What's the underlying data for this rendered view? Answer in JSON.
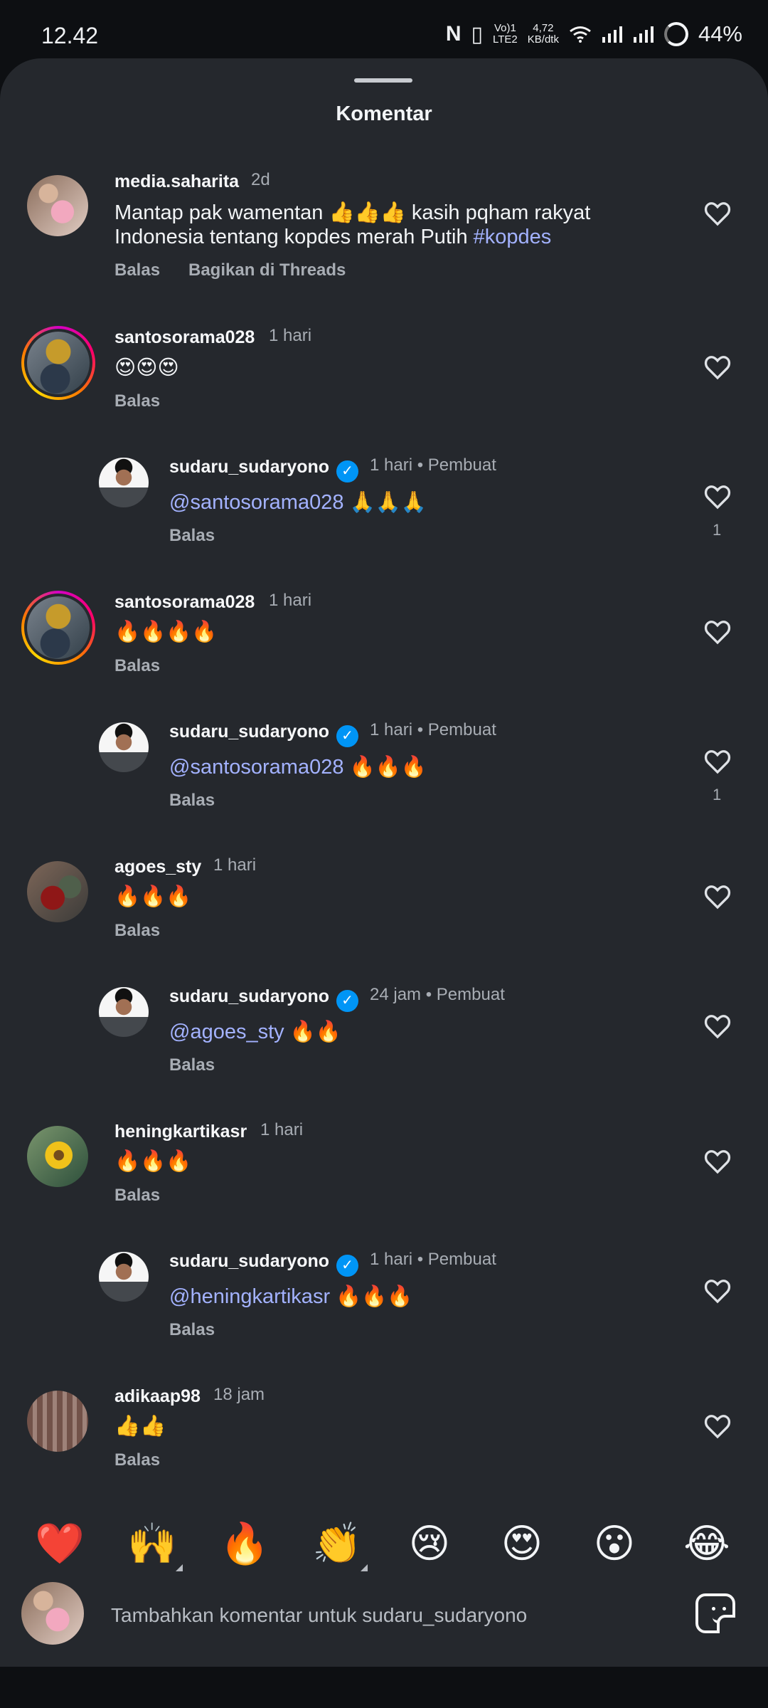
{
  "status": {
    "time": "12.42",
    "nfc": "N",
    "volte_top": "Vo)1",
    "volte_bottom": "LTE2",
    "speed_value": "4,72",
    "speed_unit": "KB/dtk",
    "battery": "44%"
  },
  "sheet": {
    "title": "Komentar"
  },
  "comments": [
    {
      "username": "media.saharita",
      "time": "2d",
      "text_plain": "Mantap pak wamentan 👍👍👍 kasih pqham rakyat",
      "text_line2_plain": "Indonesia tentang kopdes merah Putih ",
      "hashtag": "#kopdes",
      "reply": "Balas",
      "share": "Bagikan di Threads"
    },
    {
      "username": "santosorama028",
      "time": "1 hari",
      "text": "😍😍😍",
      "reply": "Balas"
    },
    {
      "username": "sudaru_sudaryono",
      "time": "1 hari",
      "author_label": "Pembuat",
      "mention": "@santosorama028",
      "text": " 🙏🙏🙏",
      "reply": "Balas",
      "likes": "1"
    },
    {
      "username": "santosorama028",
      "time": "1 hari",
      "text": "🔥🔥🔥🔥",
      "reply": "Balas"
    },
    {
      "username": "sudaru_sudaryono",
      "time": "1 hari",
      "author_label": "Pembuat",
      "mention": "@santosorama028",
      "text": " 🔥🔥🔥",
      "reply": "Balas",
      "likes": "1"
    },
    {
      "username": "agoes_sty",
      "time": "1 hari",
      "text": "🔥🔥🔥",
      "reply": "Balas"
    },
    {
      "username": "sudaru_sudaryono",
      "time": "24 jam",
      "author_label": "Pembuat",
      "mention": "@agoes_sty",
      "text": " 🔥🔥",
      "reply": "Balas"
    },
    {
      "username": "heningkartikasr",
      "time": "1 hari",
      "text": "🔥🔥🔥",
      "reply": "Balas"
    },
    {
      "username": "sudaru_sudaryono",
      "time": "1 hari",
      "author_label": "Pembuat",
      "mention": "@heningkartikasr",
      "text": " 🔥🔥🔥",
      "reply": "Balas"
    },
    {
      "username": "adikaap98",
      "time": "18 jam",
      "text": "👍👍",
      "reply": "Balas"
    }
  ],
  "quick_emojis": [
    "❤️",
    "🙌",
    "🔥",
    "👏",
    "😢",
    "😍",
    "😮",
    "😂"
  ],
  "composer": {
    "placeholder": "Tambahkan komentar untuk sudaru_sudaryono"
  },
  "colors": {
    "background": "#25282d",
    "mention": "#a3b2ff",
    "verified": "#0095f6"
  }
}
